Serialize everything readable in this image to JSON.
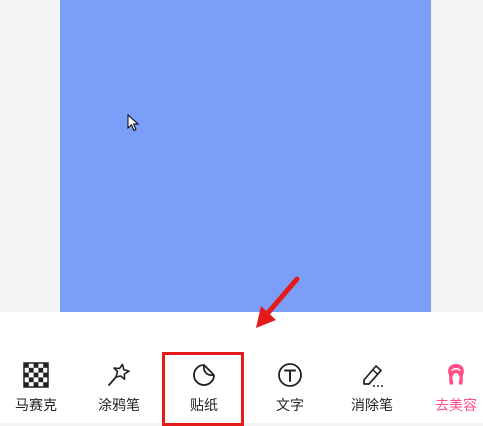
{
  "colors": {
    "canvas_bg": "#7b9ef9",
    "page_bg": "#f3f3f5",
    "toolbar_bg": "#ffffff",
    "annotation_red": "#e31b1b",
    "accent_pink": "#ff4f87"
  },
  "toolbar": {
    "items": [
      {
        "label": "马赛克",
        "icon": "mosaic-icon"
      },
      {
        "label": "涂鸦笔",
        "icon": "doodle-pen-icon"
      },
      {
        "label": "贴纸",
        "icon": "sticker-icon",
        "highlighted": true
      },
      {
        "label": "文字",
        "icon": "text-icon"
      },
      {
        "label": "消除笔",
        "icon": "eraser-pen-icon"
      },
      {
        "label": "去美容",
        "icon": "beauty-icon"
      }
    ]
  }
}
